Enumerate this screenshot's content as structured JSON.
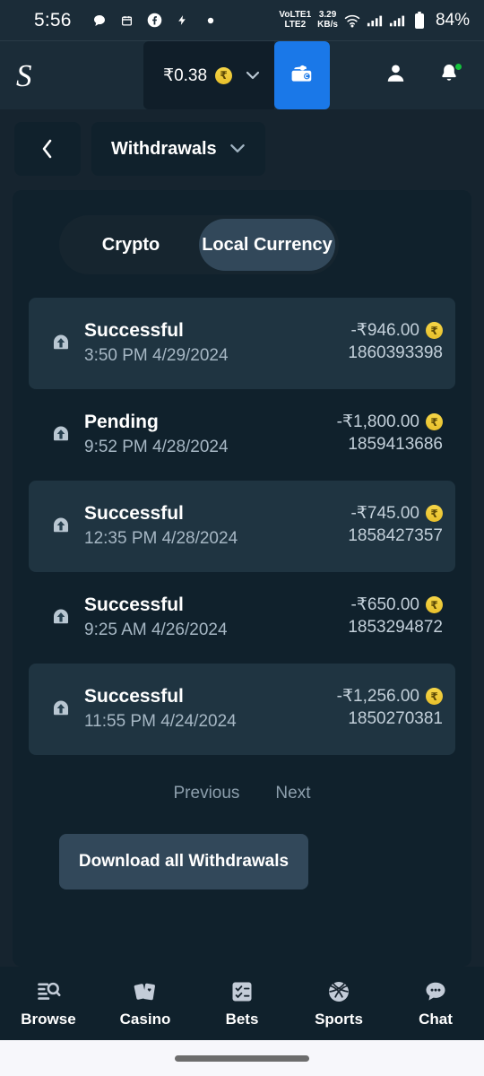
{
  "statusbar": {
    "time": "5:56",
    "left_icons": [
      "chat-bubble-icon",
      "calendar-icon",
      "facebook-icon",
      "flash-icon",
      "dot-icon"
    ],
    "network_line1": "VoLTE1",
    "network_line2": "LTE2",
    "speed_value": "3.29",
    "speed_unit": "KB/s",
    "battery": "84%"
  },
  "header": {
    "logo": "S",
    "balance": "₹0.38",
    "currency_symbol": "₹",
    "chevron": "⌄",
    "wallet_icon": "wallet-icon",
    "profile_icon": "person-icon",
    "bell_icon": "bell-icon"
  },
  "nav": {
    "back": "‹",
    "page_title": "Withdrawals",
    "chevron": "⌄"
  },
  "tabs": {
    "crypto": "Crypto",
    "local": "Local Currency",
    "active": "Local Currency"
  },
  "transactions": [
    {
      "status": "Successful",
      "date": "3:50 PM 4/29/2024",
      "amount": "-₹946.00",
      "id": "1860393398",
      "currency": "₹",
      "shaded": true
    },
    {
      "status": "Pending",
      "date": "9:52 PM 4/28/2024",
      "amount": "-₹1,800.00",
      "id": "1859413686",
      "currency": "₹",
      "shaded": false
    },
    {
      "status": "Successful",
      "date": "12:35 PM 4/28/2024",
      "amount": "-₹745.00",
      "id": "1858427357",
      "currency": "₹",
      "shaded": true
    },
    {
      "status": "Successful",
      "date": "9:25 AM 4/26/2024",
      "amount": "-₹650.00",
      "id": "1853294872",
      "currency": "₹",
      "shaded": false
    },
    {
      "status": "Successful",
      "date": "11:55 PM 4/24/2024",
      "amount": "-₹1,256.00",
      "id": "1850270381",
      "currency": "₹",
      "shaded": true
    }
  ],
  "pagination": {
    "previous": "Previous",
    "next": "Next"
  },
  "download": {
    "label": "Download all Withdrawals"
  },
  "bottomnav": [
    {
      "label": "Browse",
      "icon": "browse-search-icon"
    },
    {
      "label": "Casino",
      "icon": "playing-cards-icon"
    },
    {
      "label": "Bets",
      "icon": "bet-slip-icon"
    },
    {
      "label": "Sports",
      "icon": "basketball-icon"
    },
    {
      "label": "Chat",
      "icon": "chat-bubble-icon"
    }
  ],
  "colors": {
    "background": "#16242f",
    "surface": "#10212c",
    "row_shaded": "#1f3441",
    "accent_blue": "#1a78e8",
    "coin_gold": "#e8c02c",
    "badge_green": "#14c23c"
  }
}
